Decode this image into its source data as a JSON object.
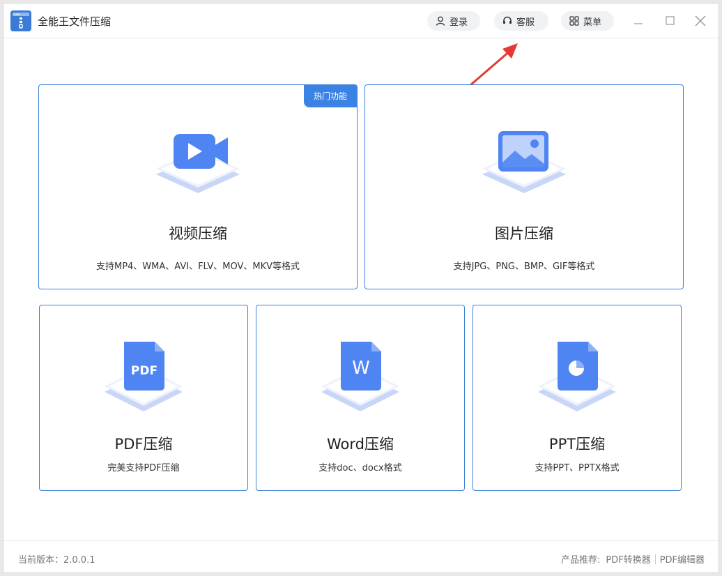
{
  "app": {
    "title": "全能王文件压缩"
  },
  "header": {
    "login_label": "登录",
    "service_label": "客服",
    "menu_label": "菜单"
  },
  "cards": {
    "video": {
      "badge": "热门功能",
      "title": "视频压缩",
      "subtitle": "支持MP4、WMA、AVI、FLV、MOV、MKV等格式"
    },
    "image": {
      "title": "图片压缩",
      "subtitle": "支持JPG、PNG、BMP、GIF等格式"
    },
    "pdf": {
      "icon_text": "PDF",
      "title": "PDF压缩",
      "subtitle": "完美支持PDF压缩"
    },
    "word": {
      "icon_text": "W",
      "title": "Word压缩",
      "subtitle": "支持doc、docx格式"
    },
    "ppt": {
      "title": "PPT压缩",
      "subtitle": "支持PPT、PPTX格式"
    }
  },
  "footer": {
    "version": "当前版本：2.0.0.1",
    "recommend_label": "产品推荐:",
    "links": [
      "PDF转换器",
      "PDF编辑器"
    ]
  },
  "colors": {
    "accent": "#3a82e4",
    "card_border": "#3d7fd8",
    "annotation_arrow": "#e53935"
  }
}
